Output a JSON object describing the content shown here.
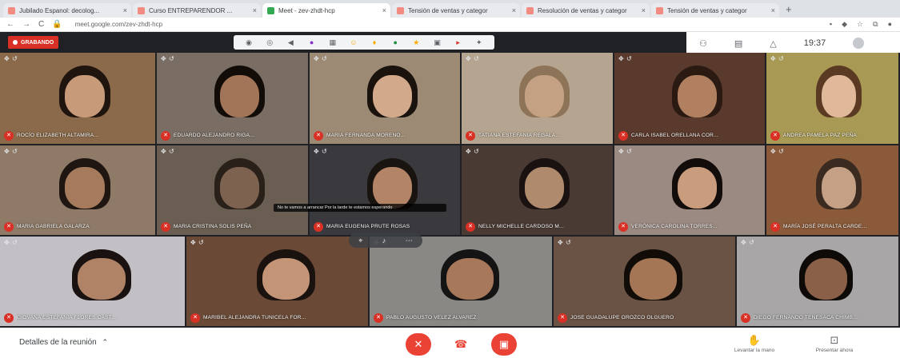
{
  "browser": {
    "tabs": [
      {
        "label": "Jubilado Espanol: decolog...",
        "fav": "#f28b82",
        "active": false
      },
      {
        "label": "Curso ENTREPARENDOR ...",
        "fav": "#f28b82",
        "active": false
      },
      {
        "label": "Meet - zev-zhdt-hcp",
        "fav": "#34a853",
        "active": true
      },
      {
        "label": "Tensión de ventas y categor",
        "fav": "#f28b82",
        "active": false
      },
      {
        "label": "Resolución de ventas y categor",
        "fav": "#f28b82",
        "active": false
      },
      {
        "label": "Tensión de ventas y categor",
        "fav": "#f28b82",
        "active": false
      }
    ],
    "new_tab": "+",
    "url": "meet.google.com/zev-zhdt-hcp"
  },
  "meet": {
    "recording_label": "GRABANDO",
    "clock": "19:37"
  },
  "participants": [
    {
      "name": "ROCÍO ELIZABETH ALTAMIRA...",
      "bg": "#8a6a4a",
      "skin": "#c79a7a",
      "hair": "#1f140e"
    },
    {
      "name": "EDUARDO ALEJANDRO RIGA...",
      "bg": "#7a6e64",
      "skin": "#a27458",
      "hair": "#120c08"
    },
    {
      "name": "MARIA FERNANDA MORENO...",
      "bg": "#9c8a74",
      "skin": "#d2a98a",
      "hair": "#1a120c"
    },
    {
      "name": "TATIANA ESTEFANIA REGALA...",
      "bg": "#b5a48f",
      "skin": "#c4a183",
      "hair": "#8d7358"
    },
    {
      "name": "CARLA ISABEL ORELLANA COR...",
      "bg": "#5a3a2c",
      "skin": "#b08060",
      "hair": "#2a1a12"
    },
    {
      "name": "ANDREA PAMELA PAZ PEÑA",
      "bg": "#a89a54",
      "skin": "#e0b89a",
      "hair": "#5a3a22"
    },
    {
      "name": "MARIA GABRIELA GALARZA",
      "bg": "#8e7a66",
      "skin": "#a67a5c",
      "hair": "#1f1612"
    },
    {
      "name": "MARIA CRISTINA SOLIS PEÑA",
      "bg": "#6a5e52",
      "skin": "#7e6250",
      "hair": "#2a201a"
    },
    {
      "name": "MARIA EUGENIA PRUTE ROSAS",
      "bg": "#3a3a3e",
      "skin": "#b48466",
      "hair": "#1a1410"
    },
    {
      "name": "NELLY MICHELLE CARDOSO M...",
      "bg": "#4a3a34",
      "skin": "#b08a6c",
      "hair": "#1a1210"
    },
    {
      "name": "VERÓNICA CAROLINA TORRES...",
      "bg": "#9a8a82",
      "skin": "#c99c7e",
      "hair": "#120c0a"
    },
    {
      "name": "MARÍA JOSÉ PERALTA CARDE...",
      "bg": "#8a5a3a",
      "skin": "#c6a084",
      "hair": "#3a2a20"
    },
    {
      "name": "GIOVANA ESTEFANIA FLORES CAST...",
      "bg": "#c2c0c4",
      "skin": "#b08266",
      "hair": "#1a1210"
    },
    {
      "name": "MARIBEL ALEJANDRA TUNICELA FOR...",
      "bg": "#6a4a36",
      "skin": "#c49476",
      "hair": "#1a120e"
    },
    {
      "name": "PABLO AUGUSTO VELEZ ALVAREZ",
      "bg": "#8a8884",
      "skin": "#a8785a",
      "hair": "#141414"
    },
    {
      "name": "JOSE GUADALUPE OROZCO OLGUERO",
      "bg": "#6a5244",
      "skin": "#a47656",
      "hair": "#120c08"
    },
    {
      "name": "DIEGO FERNANDO TENESACA CHIMB...",
      "bg": "#a8a6a6",
      "skin": "#8a6048",
      "hair": "#0e0a08"
    }
  ],
  "caption_text": "No te vamos a arrancar Por la tarde te estamos esperando",
  "bottom": {
    "details_label": "Detalles de la reunión",
    "raise_hand_label": "Levantar la mano",
    "present_label": "Presentar ahora"
  }
}
